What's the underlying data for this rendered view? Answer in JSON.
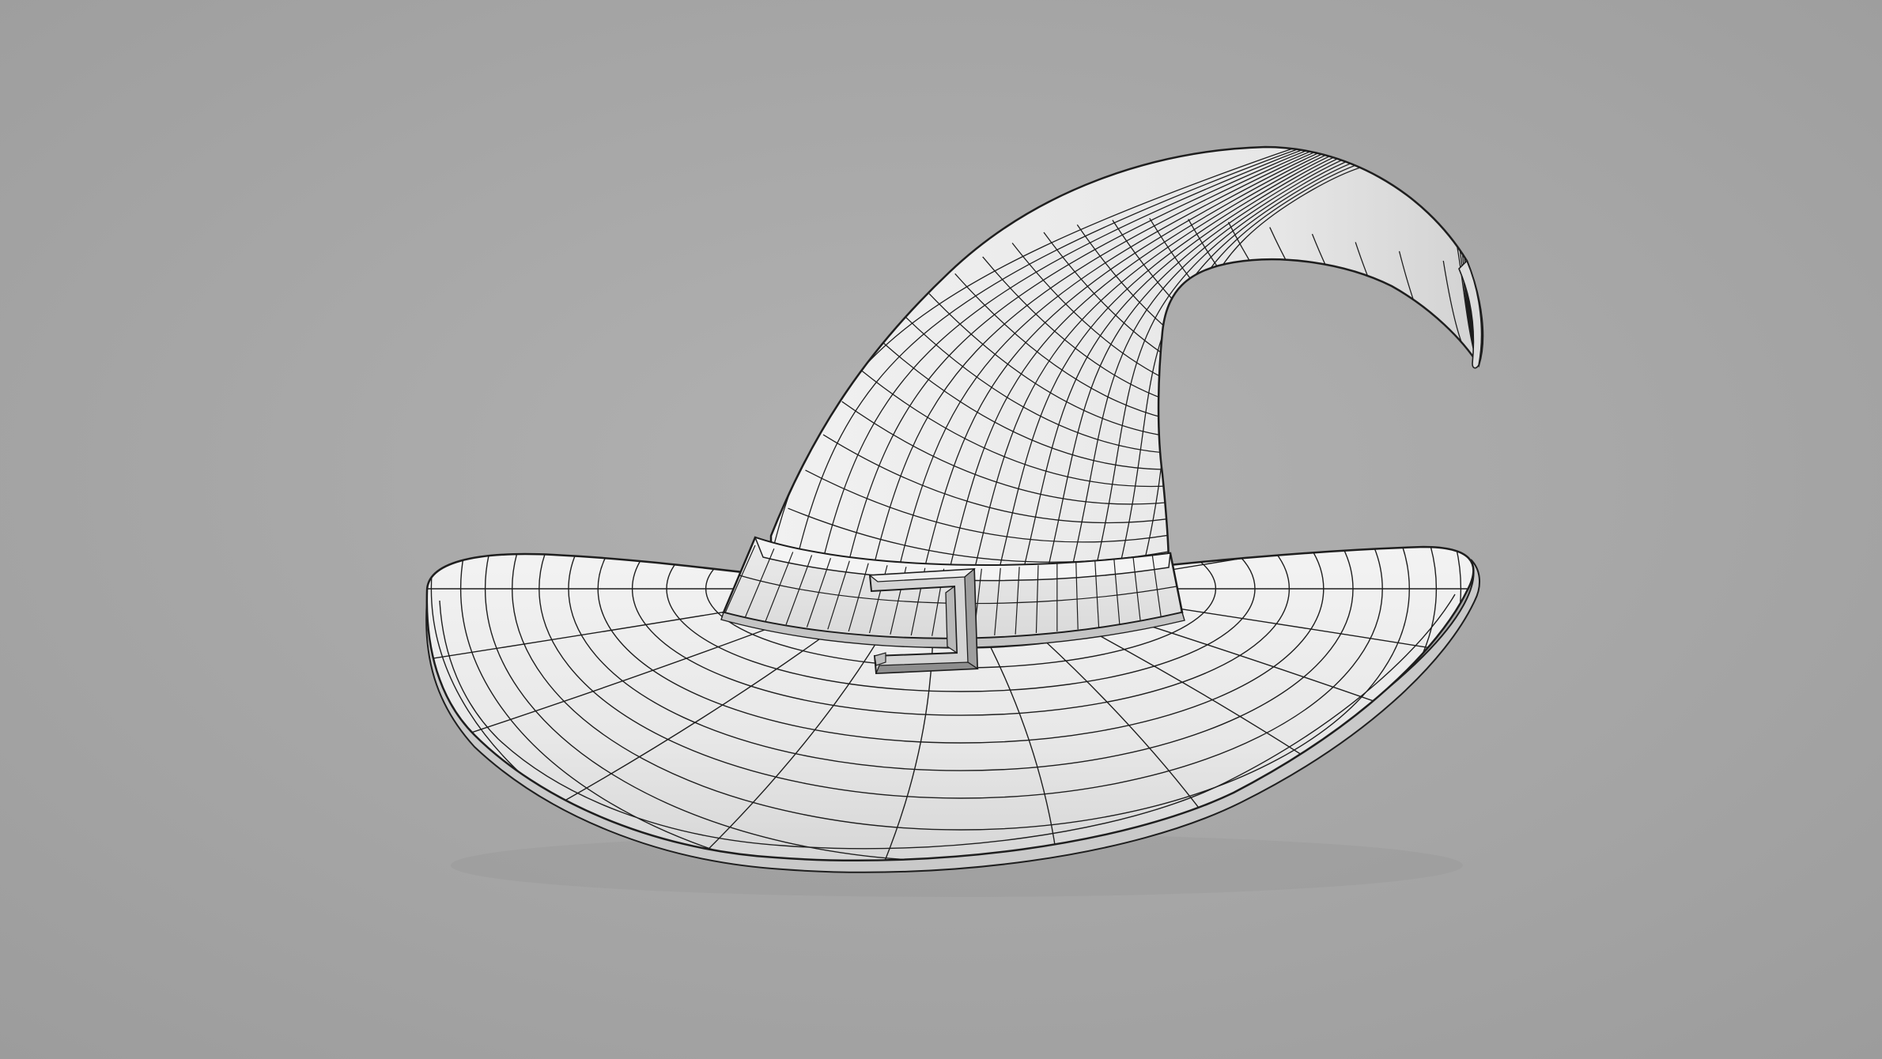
{
  "scene": {
    "subject_icon": "witch-hat-wireframe-icon",
    "background_color": "#a8a8a8",
    "surface_color": "#ececec",
    "wire_color": "#1e1e1e",
    "buckle_color": "#d4d4d4"
  }
}
